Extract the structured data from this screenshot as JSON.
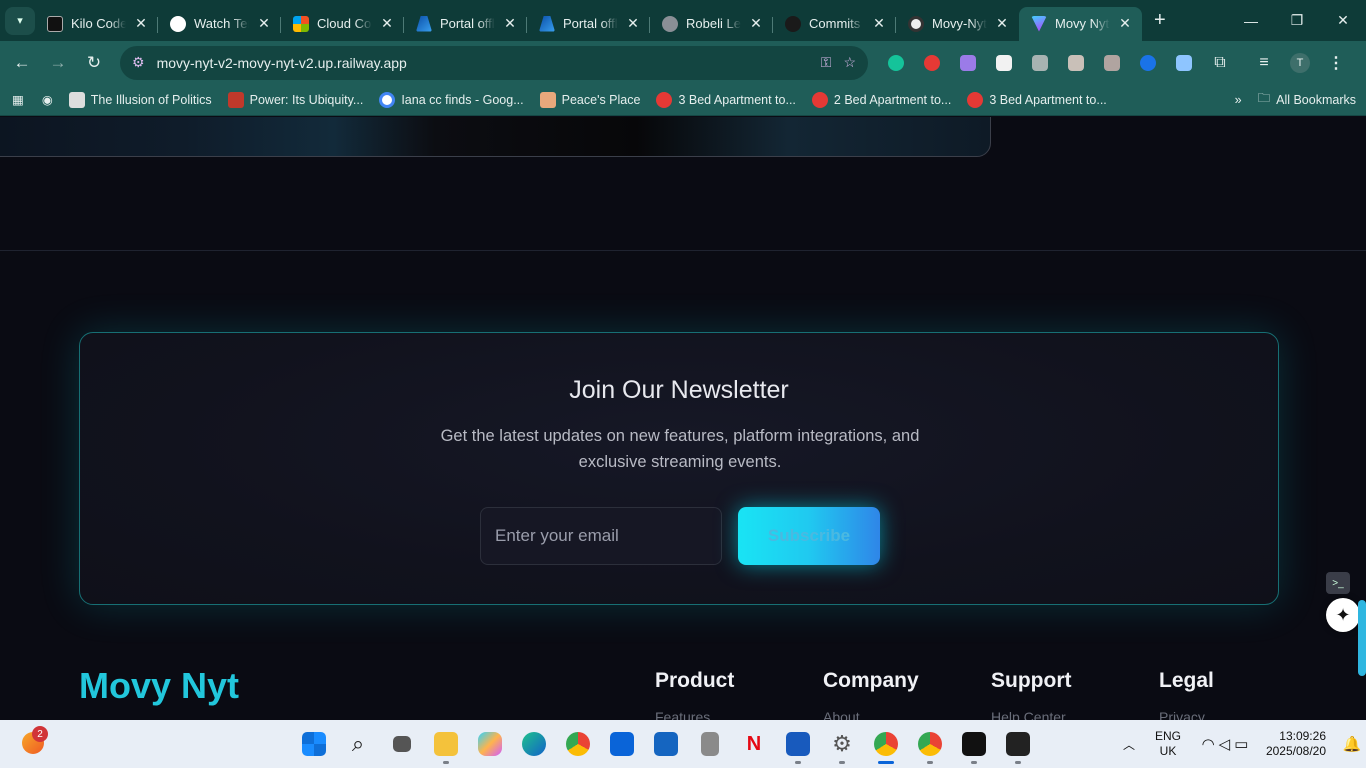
{
  "browser": {
    "tabs": [
      {
        "title": "Kilo Code",
        "favicon_color": "#111111"
      },
      {
        "title": "Watch Ter",
        "favicon_color": "#222222"
      },
      {
        "title": "Cloud Cor",
        "favicon_color": "#f25022"
      },
      {
        "title": "Portal offl",
        "favicon_color": "#1e88e5"
      },
      {
        "title": "Portal offl",
        "favicon_color": "#1e88e5"
      },
      {
        "title": "Robeli Lea",
        "favicon_color": "#888888"
      },
      {
        "title": "Commits",
        "favicon_color": "#222222"
      },
      {
        "title": "Movy-Nyt",
        "favicon_color": "#dddddd"
      },
      {
        "title": "Movy Nyt",
        "favicon_color": "#b36bff",
        "active": true
      }
    ],
    "url": "movy-nyt-v2-movy-nyt-v2.up.railway.app",
    "bookmarks": [
      {
        "label": "The Illusion of Politics",
        "color": "#dddddd"
      },
      {
        "label": "Power: Its Ubiquity...",
        "color": "#c0392b"
      },
      {
        "label": "Iana cc finds - Goog...",
        "color": "#4285f4"
      },
      {
        "label": "Peace's Place",
        "color": "#e8a87c"
      },
      {
        "label": "3 Bed Apartment to...",
        "color": "#e53935"
      },
      {
        "label": "2 Bed Apartment to...",
        "color": "#e53935"
      },
      {
        "label": "3 Bed Apartment to...",
        "color": "#e53935"
      }
    ],
    "all_bookmarks_label": "All Bookmarks",
    "profile_initial": "T"
  },
  "newsletter": {
    "title": "Join Our Newsletter",
    "description": "Get the latest updates on new features, platform integrations, and exclusive streaming events.",
    "email_placeholder": "Enter your email",
    "subscribe_label": "Subscribe"
  },
  "footer": {
    "brand": "Movy Nyt",
    "columns": [
      {
        "heading": "Product",
        "first_link": "Features"
      },
      {
        "heading": "Company",
        "first_link": "About"
      },
      {
        "heading": "Support",
        "first_link": "Help Center"
      },
      {
        "heading": "Legal",
        "first_link": "Privacy"
      }
    ]
  },
  "taskbar": {
    "notification_count": "2",
    "language": "ENG",
    "region": "UK",
    "time": "13:09:26",
    "date": "2025/08/20"
  },
  "accent_color": "#22c7dc"
}
